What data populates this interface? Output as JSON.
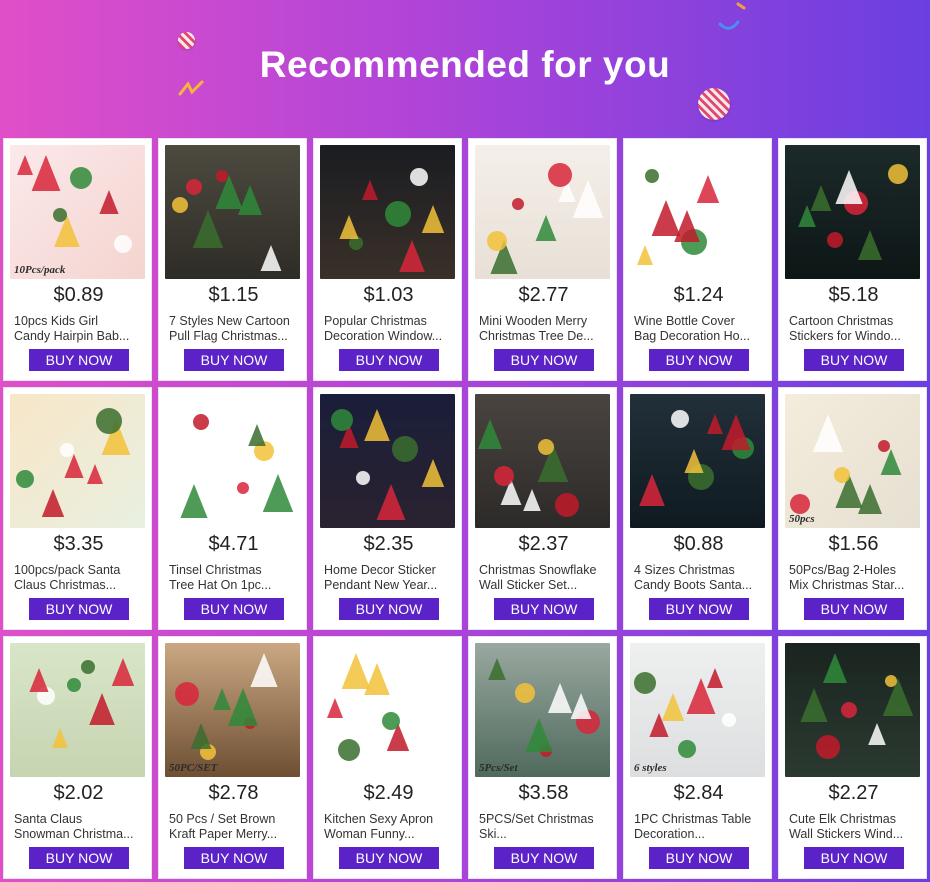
{
  "header": {
    "title": "Recommended for you"
  },
  "colors": {
    "button": "#5b22c7",
    "gradient_start": "#e04fc8",
    "gradient_end": "#6a3fe0"
  },
  "products": [
    {
      "price": "$0.89",
      "title_line1": "10pcs Kids Girl",
      "title_line2": "Candy Hairpin Bab...",
      "button": "BUY NOW",
      "image": "hairpins-image",
      "caption": "10Pcs/pack",
      "bg": "linear-gradient(135deg,#fbe9ea,#f4d4cf)"
    },
    {
      "price": "$1.15",
      "title_line1": "7 Styles New Cartoon",
      "title_line2": "Pull Flag Christmas...",
      "button": "BUY NOW",
      "image": "flag-garland-image",
      "caption": "",
      "bg": "linear-gradient(180deg,#4d4a40,#2e2c26)"
    },
    {
      "price": "$1.03",
      "title_line1": "Popular Christmas",
      "title_line2": "Decoration Window...",
      "button": "BUY NOW",
      "image": "window-sticker-image",
      "caption": "",
      "bg": "linear-gradient(180deg,#1a1c22,#3a3028)"
    },
    {
      "price": "$2.77",
      "title_line1": "Mini Wooden Merry",
      "title_line2": "Christmas Tree De...",
      "button": "BUY NOW",
      "image": "wooden-tree-image",
      "caption": "",
      "bg": "linear-gradient(180deg,#f4efe9,#e8e0d6)"
    },
    {
      "price": "$1.24",
      "title_line1": "Wine Bottle Cover",
      "title_line2": "Bag Decoration Ho...",
      "button": "BUY NOW",
      "image": "bottle-cover-image",
      "caption": "",
      "bg": "#ffffff"
    },
    {
      "price": "$5.18",
      "title_line1": "Cartoon Christmas",
      "title_line2": "Stickers for Windo...",
      "button": "BUY NOW",
      "image": "santa-window-image",
      "caption": "",
      "bg": "linear-gradient(180deg,#1c2a2a,#0e1616)"
    },
    {
      "price": "$3.35",
      "title_line1": "100pcs/pack Santa",
      "title_line2": "Claus Christmas...",
      "button": "BUY NOW",
      "image": "stickers-pack-image",
      "caption": "",
      "bg": "linear-gradient(135deg,#f8e6c8,#e8f0e0)"
    },
    {
      "price": "$4.71",
      "title_line1": "Tinsel Christmas",
      "title_line2": "Tree Hat On 1pc...",
      "button": "BUY NOW",
      "image": "tree-hat-image",
      "caption": "",
      "bg": "#ffffff"
    },
    {
      "price": "$2.35",
      "title_line1": "Home Decor Sticker",
      "title_line2": "Pendant New Year...",
      "button": "BUY NOW",
      "image": "pendant-sticker-image",
      "caption": "",
      "bg": "linear-gradient(180deg,#1a1e3a,#2a2230)"
    },
    {
      "price": "$2.37",
      "title_line1": "Christmas Snowflake",
      "title_line2": "Wall Sticker Set...",
      "button": "BUY NOW",
      "image": "snowflake-image",
      "caption": "",
      "bg": "linear-gradient(180deg,#4a4440,#2c2a28)"
    },
    {
      "price": "$0.88",
      "title_line1": "4 Sizes Christmas",
      "title_line2": "Candy Boots Santa...",
      "button": "BUY NOW",
      "image": "candy-boots-image",
      "caption": "",
      "bg": "linear-gradient(180deg,#22303a,#0f1a20)"
    },
    {
      "price": "$1.56",
      "title_line1": "50Pcs/Bag 2-Holes",
      "title_line2": "Mix Christmas Star...",
      "button": "BUY NOW",
      "image": "buttons-image",
      "caption": "50pcs",
      "bg": "linear-gradient(135deg,#f4ecdc,#e6e0d2)"
    },
    {
      "price": "$2.02",
      "title_line1": "Santa Claus",
      "title_line2": "Snowman Christma...",
      "button": "BUY NOW",
      "image": "towel-cake-image",
      "caption": "",
      "bg": "linear-gradient(180deg,#d8e6c8,#c7d4b2)"
    },
    {
      "price": "$2.78",
      "title_line1": "50 Pcs / Set Brown",
      "title_line2": "Kraft Paper Merry...",
      "button": "BUY NOW",
      "image": "kraft-tags-image",
      "caption": "50PC/SET",
      "bg": "linear-gradient(180deg,#cba883,#6e4f33)"
    },
    {
      "price": "$2.49",
      "title_line1": "Kitchen Sexy Apron",
      "title_line2": "Woman Funny...",
      "button": "BUY NOW",
      "image": "aprons-image",
      "caption": "",
      "bg": "#ffffff"
    },
    {
      "price": "$3.58",
      "title_line1": "5PCS/Set Christmas",
      "title_line2": "Ski...",
      "button": "BUY NOW",
      "image": "ski-ornaments-image",
      "caption": "5Pcs/Set",
      "bg": "linear-gradient(180deg,#9aa8a0,#4f6a5c)"
    },
    {
      "price": "$2.84",
      "title_line1": "1PC Christmas Table",
      "title_line2": "Decoration...",
      "button": "BUY NOW",
      "image": "tablecloth-image",
      "caption": "6 styles",
      "bg": "linear-gradient(180deg,#eef0f0,#dcdedf)"
    },
    {
      "price": "$2.27",
      "title_line1": "Cute Elk Christmas",
      "title_line2": "Wall Stickers Wind...",
      "button": "BUY NOW",
      "image": "elk-window-image",
      "caption": "",
      "bg": "linear-gradient(180deg,#1a2420,#2b3a30)"
    }
  ]
}
